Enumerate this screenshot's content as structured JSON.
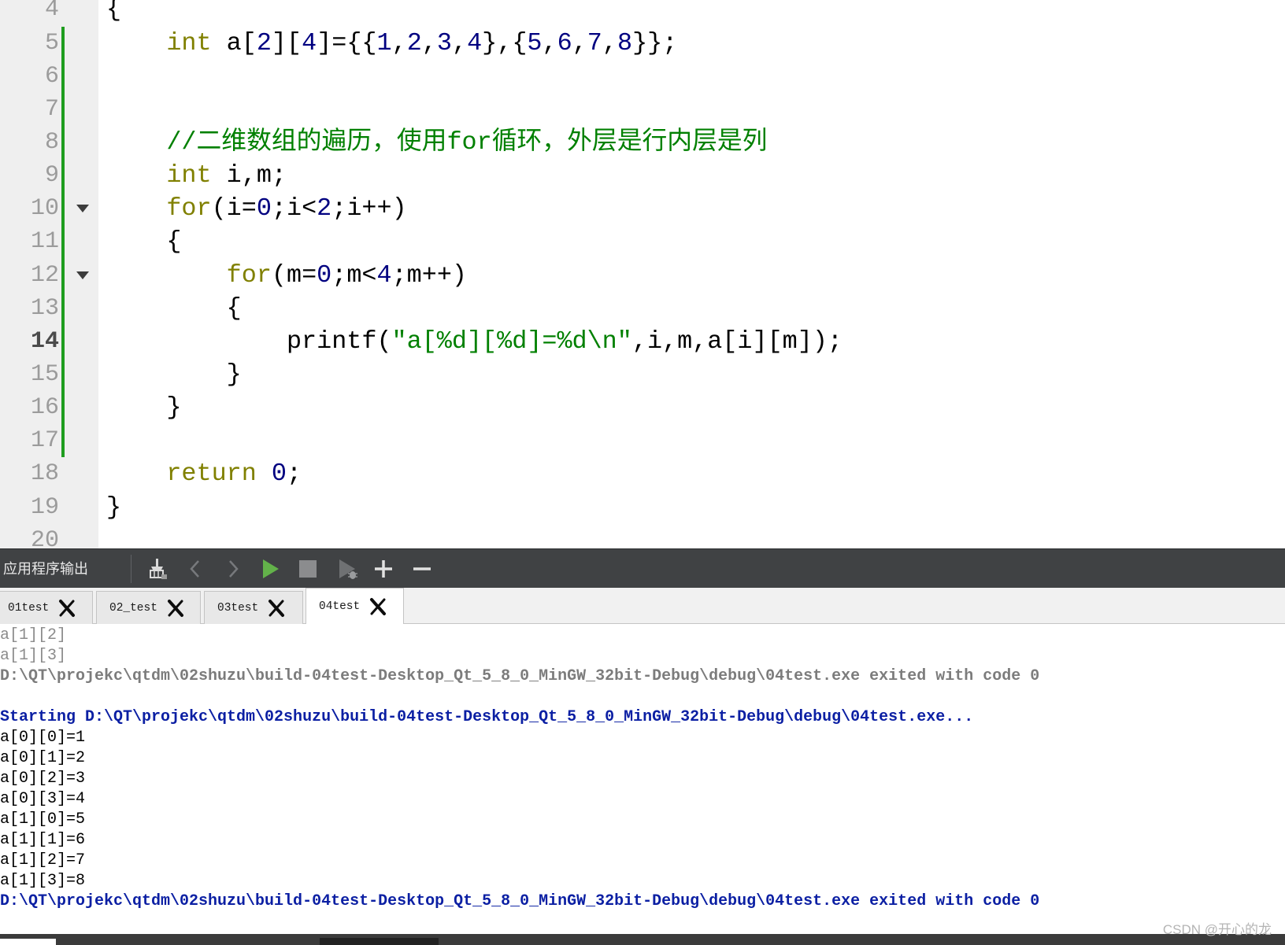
{
  "editor": {
    "current_line": 14,
    "colors": {
      "keyword": "#808000",
      "number": "#000080",
      "comment": "#008000",
      "string": "#008000",
      "plain": "#000000",
      "change_marker": "#1f9d1f"
    },
    "lines": [
      {
        "number": "4",
        "changed": false,
        "foldable": false,
        "tokens": [
          {
            "type": "plain",
            "text": "{"
          }
        ]
      },
      {
        "number": "5",
        "changed": true,
        "foldable": false,
        "tokens": [
          {
            "type": "plain",
            "text": "    "
          },
          {
            "type": "keyword",
            "text": "int"
          },
          {
            "type": "plain",
            "text": " a["
          },
          {
            "type": "number",
            "text": "2"
          },
          {
            "type": "plain",
            "text": "]["
          },
          {
            "type": "number",
            "text": "4"
          },
          {
            "type": "plain",
            "text": "]={{"
          },
          {
            "type": "number",
            "text": "1"
          },
          {
            "type": "plain",
            "text": ","
          },
          {
            "type": "number",
            "text": "2"
          },
          {
            "type": "plain",
            "text": ","
          },
          {
            "type": "number",
            "text": "3"
          },
          {
            "type": "plain",
            "text": ","
          },
          {
            "type": "number",
            "text": "4"
          },
          {
            "type": "plain",
            "text": "},{"
          },
          {
            "type": "number",
            "text": "5"
          },
          {
            "type": "plain",
            "text": ","
          },
          {
            "type": "number",
            "text": "6"
          },
          {
            "type": "plain",
            "text": ","
          },
          {
            "type": "number",
            "text": "7"
          },
          {
            "type": "plain",
            "text": ","
          },
          {
            "type": "number",
            "text": "8"
          },
          {
            "type": "plain",
            "text": "}};"
          }
        ]
      },
      {
        "number": "6",
        "changed": true,
        "foldable": false,
        "tokens": []
      },
      {
        "number": "7",
        "changed": true,
        "foldable": false,
        "tokens": []
      },
      {
        "number": "8",
        "changed": true,
        "foldable": false,
        "tokens": [
          {
            "type": "plain",
            "text": "    "
          },
          {
            "type": "comment",
            "text": "//二维数组的遍历，使用for循环，外层是行内层是列"
          }
        ]
      },
      {
        "number": "9",
        "changed": true,
        "foldable": false,
        "tokens": [
          {
            "type": "plain",
            "text": "    "
          },
          {
            "type": "keyword",
            "text": "int"
          },
          {
            "type": "plain",
            "text": " i,m;"
          }
        ]
      },
      {
        "number": "10",
        "changed": true,
        "foldable": true,
        "tokens": [
          {
            "type": "plain",
            "text": "    "
          },
          {
            "type": "keyword",
            "text": "for"
          },
          {
            "type": "plain",
            "text": "(i="
          },
          {
            "type": "number",
            "text": "0"
          },
          {
            "type": "plain",
            "text": ";i<"
          },
          {
            "type": "number",
            "text": "2"
          },
          {
            "type": "plain",
            "text": ";i++)"
          }
        ]
      },
      {
        "number": "11",
        "changed": true,
        "foldable": false,
        "tokens": [
          {
            "type": "plain",
            "text": "    {"
          }
        ]
      },
      {
        "number": "12",
        "changed": true,
        "foldable": true,
        "tokens": [
          {
            "type": "plain",
            "text": "        "
          },
          {
            "type": "keyword",
            "text": "for"
          },
          {
            "type": "plain",
            "text": "(m="
          },
          {
            "type": "number",
            "text": "0"
          },
          {
            "type": "plain",
            "text": ";m<"
          },
          {
            "type": "number",
            "text": "4"
          },
          {
            "type": "plain",
            "text": ";m++)"
          }
        ]
      },
      {
        "number": "13",
        "changed": true,
        "foldable": false,
        "tokens": [
          {
            "type": "plain",
            "text": "        {"
          }
        ]
      },
      {
        "number": "14",
        "changed": true,
        "foldable": false,
        "tokens": [
          {
            "type": "plain",
            "text": "            printf("
          },
          {
            "type": "string",
            "text": "\"a[%d][%d]=%d\\n\""
          },
          {
            "type": "plain",
            "text": ",i,m,a[i][m]);"
          }
        ]
      },
      {
        "number": "15",
        "changed": true,
        "foldable": false,
        "tokens": [
          {
            "type": "plain",
            "text": "        }"
          }
        ]
      },
      {
        "number": "16",
        "changed": true,
        "foldable": false,
        "tokens": [
          {
            "type": "plain",
            "text": "    }"
          }
        ]
      },
      {
        "number": "17",
        "changed": true,
        "foldable": false,
        "tokens": []
      },
      {
        "number": "18",
        "changed": false,
        "foldable": false,
        "tokens": [
          {
            "type": "plain",
            "text": "    "
          },
          {
            "type": "keyword",
            "text": "return"
          },
          {
            "type": "plain",
            "text": " "
          },
          {
            "type": "number",
            "text": "0"
          },
          {
            "type": "plain",
            "text": ";"
          }
        ]
      },
      {
        "number": "19",
        "changed": false,
        "foldable": false,
        "tokens": [
          {
            "type": "plain",
            "text": "}"
          }
        ]
      },
      {
        "number": "20",
        "changed": false,
        "foldable": false,
        "tokens": []
      }
    ]
  },
  "output_panel": {
    "title": "应用程序输出",
    "toolbar_icons": [
      "broom-icon",
      "chevron-left-icon",
      "chevron-right-icon",
      "run-icon",
      "stop-icon",
      "attach-debugger-icon",
      "plus-icon",
      "minus-icon"
    ],
    "tabs": [
      {
        "label": "01test",
        "active": false
      },
      {
        "label": "02_test",
        "active": false
      },
      {
        "label": "03test",
        "active": false
      },
      {
        "label": "04test",
        "active": true
      }
    ],
    "colors": {
      "old": "#8c8c8c",
      "old-message": "#7c7c7c",
      "message": "#0b1fa3",
      "stdout": "#000000",
      "blank": "#000000"
    },
    "lines": [
      {
        "style": "old",
        "text": "a[1][2]"
      },
      {
        "style": "old",
        "text": "a[1][3]"
      },
      {
        "style": "old-message",
        "text": "D:\\QT\\projekc\\qtdm\\02shuzu\\build-04test-Desktop_Qt_5_8_0_MinGW_32bit-Debug\\debug\\04test.exe exited with code 0"
      },
      {
        "style": "blank",
        "text": ""
      },
      {
        "style": "message",
        "text": "Starting D:\\QT\\projekc\\qtdm\\02shuzu\\build-04test-Desktop_Qt_5_8_0_MinGW_32bit-Debug\\debug\\04test.exe..."
      },
      {
        "style": "stdout",
        "text": "a[0][0]=1"
      },
      {
        "style": "stdout",
        "text": "a[0][1]=2"
      },
      {
        "style": "stdout",
        "text": "a[0][2]=3"
      },
      {
        "style": "stdout",
        "text": "a[0][3]=4"
      },
      {
        "style": "stdout",
        "text": "a[1][0]=5"
      },
      {
        "style": "stdout",
        "text": "a[1][1]=6"
      },
      {
        "style": "stdout",
        "text": "a[1][2]=7"
      },
      {
        "style": "stdout",
        "text": "a[1][3]=8"
      },
      {
        "style": "message",
        "text": "D:\\QT\\projekc\\qtdm\\02shuzu\\build-04test-Desktop_Qt_5_8_0_MinGW_32bit-Debug\\debug\\04test.exe exited with code 0"
      }
    ]
  },
  "watermark": "CSDN @开心的龙"
}
